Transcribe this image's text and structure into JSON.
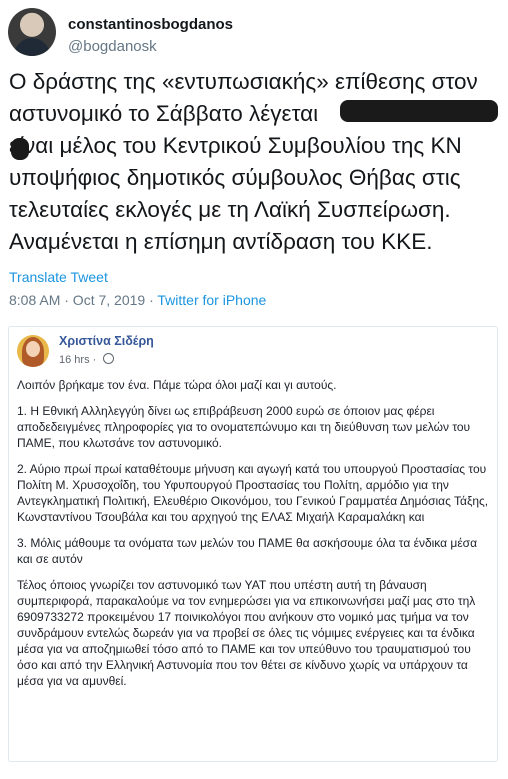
{
  "author": {
    "display_name": "constantinosbogdanos",
    "handle": "@bogdanosk"
  },
  "tweet": {
    "text": "Ο δράστης της «εντυπωσιακής» επίθεσης στον\nαστυνομικό το Σάββατο λέγεται\n   είναι μέλος του Κεντρικού Συμβουλίου της ΚΝ\nυποψήφιος δημοτικός σύμβουλος Θήβας στις\nτελευταίες εκλογές με τη Λαϊκή Συσπείρωση.\nΑναμένεται η επίσημη αντίδραση του ΚΚΕ.",
    "translate_label": "Translate Tweet",
    "timestamp": "8:08 AM · Oct 7, 2019 · ",
    "source": "Twitter for iPhone"
  },
  "embedded_post": {
    "author_name": "Χριστίνα Σιδέρη",
    "time": "16 hrs · ",
    "paragraphs": [
      "Λοιπόν βρήκαμε τον ένα. Πάμε τώρα όλοι μαζί και γι αυτούς.",
      "1. Η Εθνική Αλληλεγγύη δίνει ως επιβράβευση 2000 ευρώ σε όποιον μας φέρει αποδεδειγμένες πληροφορίες για το ονοματεπώνυμο και τη διεύθυνση των μελών του ΠΑΜΕ, που κλωτσάνε τον αστυνομικό.",
      "2. Αύριο πρωί πρωί καταθέτουμε μήνυση και αγωγή κατά του υπουργού Προστασίας του Πολίτη Μ. Χρυσοχοΐδη, του Υφυπουργού Προστασίας του Πολίτη, αρμόδιο για την Αντεγκληματική Πολιτική, Ελευθέριο Οικονόμου, του Γενικού Γραμματέα Δημόσιας Τάξης, Κωνσταντίνου Τσουβάλα και του αρχηγού της ΕΛΑΣ Μιχαήλ Καραμαλάκη και",
      "3. Μόλις μάθουμε τα ονόματα των μελών του ΠΑΜΕ θα ασκήσουμε όλα τα ένδικα μέσα και σε αυτόν",
      "Τέλος όποιος γνωρίζει τον αστυνομικό των ΥΑΤ που υπέστη αυτή τη βάναυση συμπεριφορά, παρακαλούμε να τον ενημερώσει για να επικοινωνήσει μαζί μας στο τηλ 6909733272 προκειμένου 17 ποινικολόγοι που ανήκουν στο νομικό μας τμήμα να τον συνδράμουν εντελώς δωρεάν για να προβεί σε όλες τις νόμιμες ενέργειες και τα ένδικα μέσα για να αποζημιωθεί τόσο από το ΠΑΜΕ και τον υπεύθυνο του τραυματισμού του όσο και από την Ελληνική Αστυνομία που τον θέτει σε κίνδυνο χωρίς να υπάρχουν τα μέσα για να αμυνθεί."
    ]
  }
}
